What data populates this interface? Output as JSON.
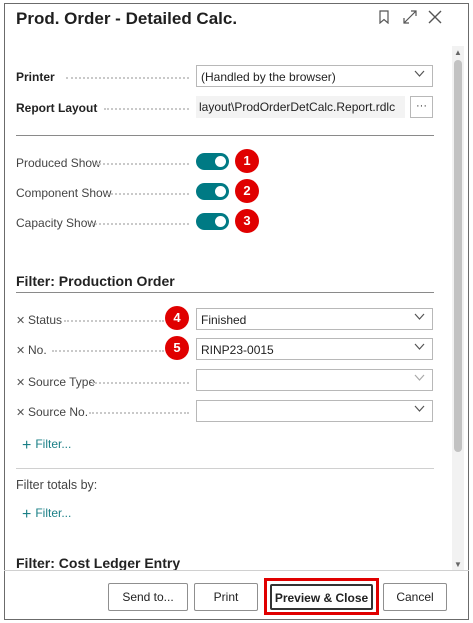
{
  "dialog": {
    "title": "Prod. Order - Detailed Calc.",
    "icons": [
      "bookmark-icon",
      "expand-icon",
      "close-icon"
    ]
  },
  "settings": {
    "printer_label": "Printer",
    "printer_value": "(Handled by the browser)",
    "layout_label": "Report Layout",
    "layout_value": "layout\\ProdOrderDetCalc.Report.rdlc",
    "layout_button": "···"
  },
  "options": [
    {
      "label": "Produced Show",
      "on": true,
      "badge": "1"
    },
    {
      "label": "Component Show",
      "on": true,
      "badge": "2"
    },
    {
      "label": "Capacity Show",
      "on": true,
      "badge": "3"
    }
  ],
  "filter_production_order": {
    "title": "Filter: Production Order",
    "rows": [
      {
        "label": "Status",
        "value": "Finished",
        "badge": "4"
      },
      {
        "label": "No.",
        "value": "RINP23-0015",
        "badge": "5"
      },
      {
        "label": "Source Type",
        "value": ""
      },
      {
        "label": "Source No.",
        "value": ""
      }
    ],
    "add_filter": "Filter...",
    "totals_label": "Filter totals by:",
    "totals_add_filter": "Filter..."
  },
  "filter_cost_ledger": {
    "title": "Filter: Cost Ledger Entry"
  },
  "footer": {
    "send_to": "Send to...",
    "print": "Print",
    "preview_close": "Preview & Close",
    "cancel": "Cancel"
  },
  "colors": {
    "toggle_on": "#007a84",
    "badge": "#e00000",
    "link": "#1a7f86"
  }
}
